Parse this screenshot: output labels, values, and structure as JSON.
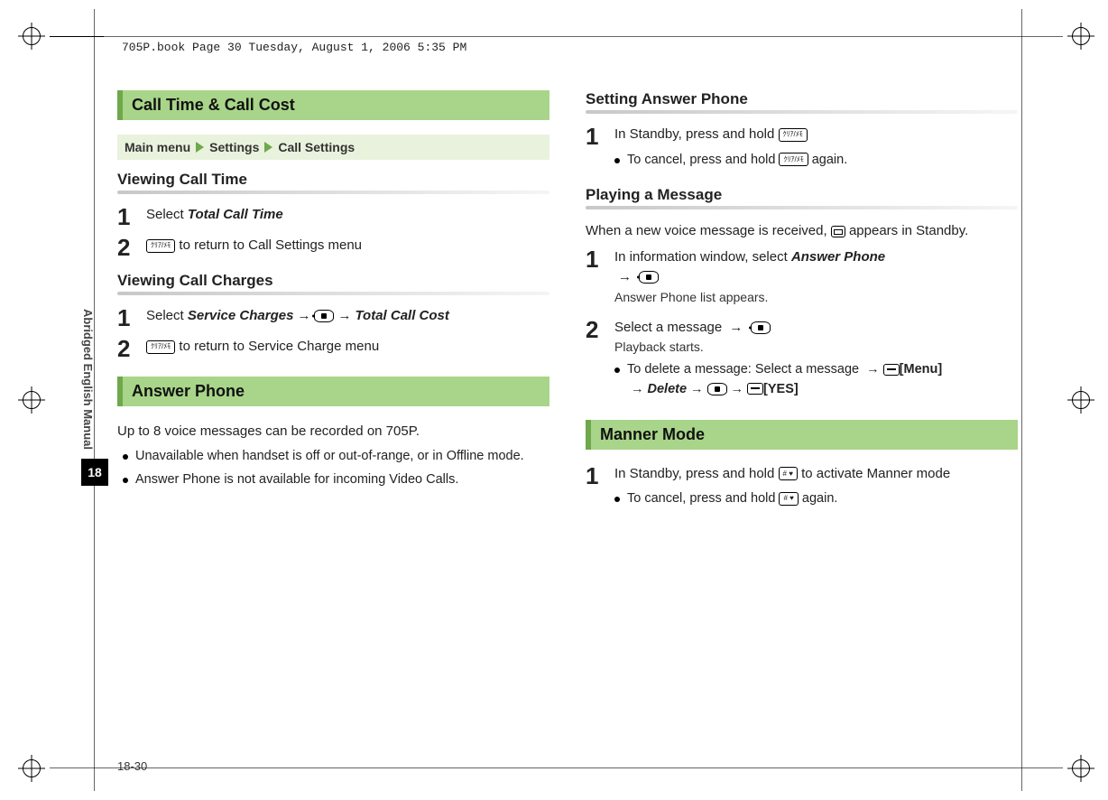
{
  "header_text": "705P.book  Page 30  Tuesday, August 1, 2006  5:35 PM",
  "sidebar_label": "Abridged English Manual",
  "chapter_num": "18",
  "page_num": "18-30",
  "left": {
    "banner1": "Call Time & Call Cost",
    "breadcrumb": {
      "a": "Main menu",
      "b": "Settings",
      "c": "Call Settings"
    },
    "sub1": "Viewing Call Time",
    "s1_num1": "1",
    "s1_t1a": "Select ",
    "s1_t1b": "Total Call Time",
    "s1_num2": "2",
    "s1_key2": "ｸﾘｱ/ﾒﾓ",
    "s1_t2b": " to return to Call Settings menu",
    "sub2": "Viewing Call Charges",
    "s2_num1": "1",
    "s2_t1a": "Select ",
    "s2_t1b": "Service Charges",
    "s2_t1c": "Total Call Cost",
    "s2_num2": "2",
    "s2_key2": "ｸﾘｱ/ﾒﾓ",
    "s2_t2b": " to return to Service Charge menu",
    "banner2": "Answer Phone",
    "p1": "Up to 8 voice messages can be recorded on 705P.",
    "b1": "Unavailable when handset is off or out-of-range, or in Offline mode.",
    "b2": "Answer Phone is not available for incoming Video Calls."
  },
  "right": {
    "sub1": "Setting Answer Phone",
    "r1_num1": "1",
    "r1_t1a": "In Standby, press and hold ",
    "r1_key1": "ｸﾘｱ/ﾒﾓ",
    "r1_b1a": "To cancel, press and hold ",
    "r1_key1b": "ｸﾘｱ/ﾒﾓ",
    "r1_b1b": " again.",
    "sub2": "Playing a Message",
    "r2_intro_a": "When a new voice message is received, ",
    "r2_intro_b": " appears in Standby.",
    "r2_num1": "1",
    "r2_t1a": "In information window, select ",
    "r2_t1b": "Answer Phone",
    "r2_t1_sub": "Answer Phone list appears.",
    "r2_num2": "2",
    "r2_t2a": "Select a message ",
    "r2_t2_sub": "Playback starts.",
    "r2_b2a": "To delete a message: Select a message ",
    "r2_menu": "[Menu]",
    "r2_delete": "Delete",
    "r2_yes": "[YES]",
    "banner3": "Manner Mode",
    "r3_num1": "1",
    "r3_t1a": "In Standby, press and hold ",
    "r3_key1": "# ♥",
    "r3_t1b": " to activate Manner mode",
    "r3_b1a": "To cancel, press and hold ",
    "r3_key1b": "# ♥",
    "r3_b1b": " again."
  }
}
